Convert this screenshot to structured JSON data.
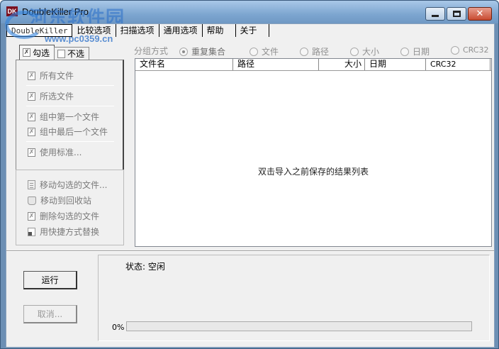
{
  "window": {
    "title": "DoubleKiller Pro",
    "app_icon_text": "DK",
    "watermark": "河东软件园",
    "watermark_url": "www.pc0359.cn"
  },
  "menu": {
    "items": [
      "DoubleKiller",
      "比较选项",
      "扫描选项",
      "通用选项",
      "帮助",
      "关于"
    ]
  },
  "left_tabs": {
    "tabs": [
      {
        "label": "勾选",
        "active": true
      },
      {
        "label": "不选",
        "active": false
      }
    ]
  },
  "select_panel": {
    "items": [
      "所有文件",
      "所选文件",
      "组中第一个文件",
      "组中最后一个文件",
      "使用标准..."
    ]
  },
  "action_panel": {
    "items": [
      "移动勾选的文件...",
      "移动到回收站",
      "删除勾选的文件",
      "用快捷方式替换"
    ]
  },
  "grouping": {
    "label": "分组方式",
    "options": [
      {
        "label": "重复集合",
        "selected": true
      },
      {
        "label": "文件",
        "selected": false
      },
      {
        "label": "路径",
        "selected": false
      },
      {
        "label": "大小",
        "selected": false
      },
      {
        "label": "日期",
        "selected": false
      },
      {
        "label": "CRC32",
        "selected": false
      }
    ]
  },
  "result_list": {
    "columns": [
      "文件名",
      "路径",
      "大小",
      "日期",
      "CRC32"
    ],
    "empty_message": "双击导入之前保存的结果列表"
  },
  "controls": {
    "run_label": "运行",
    "cancel_label": "取消..."
  },
  "status": {
    "text": "状态: 空闲",
    "progress_label": "0%",
    "progress_value": 0
  },
  "colors": {
    "titlebar": "#7da6d0",
    "close_button": "#c84a30",
    "disabled_text": "#7a7a7a"
  }
}
